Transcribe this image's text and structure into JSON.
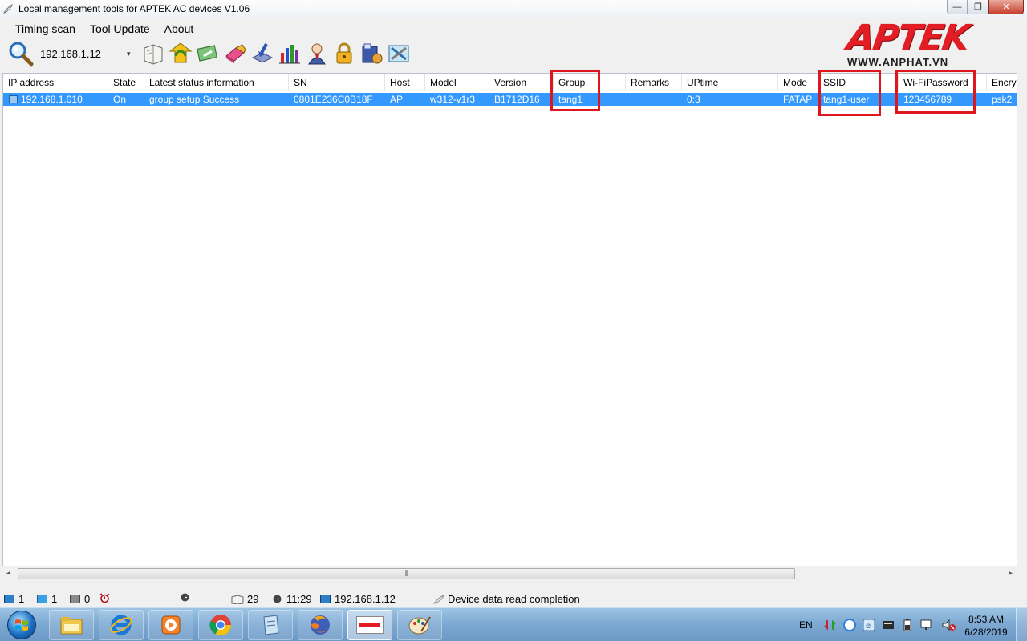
{
  "window": {
    "title": "Local management tools for APTEK AC devices  V1.06",
    "minimize": "—",
    "maximize": "❐",
    "close": "✕"
  },
  "menu": [
    "Timing scan",
    "Tool Update",
    "About"
  ],
  "toolbar": {
    "ip": "192.168.1.12",
    "combo_arrow": "▾"
  },
  "logo": {
    "mark": "APTEK",
    "url": "WWW.ANPHAT.VN"
  },
  "table": {
    "columns": [
      "IP address",
      "State",
      "Latest status information",
      "SN",
      "Host",
      "Model",
      "Version",
      "Group",
      "Remarks",
      "UPtime",
      "Mode",
      "SSID",
      "Wi-FiPassword",
      "Encry"
    ],
    "rows": [
      [
        "192.168.1.010",
        "On",
        "group setup Success",
        "0801E236C0B18F",
        "AP",
        "w312-v1r3",
        "B1712D16",
        "tang1",
        "",
        "0:3",
        "FATAP",
        "tang1-user",
        "123456789",
        "psk2"
      ]
    ]
  },
  "scrollbar": {
    "left": "◂",
    "right": "▸",
    "grip": "⦀"
  },
  "status": {
    "online": "1",
    "devices": "1",
    "offline": "0",
    "count": "29",
    "time": "11:29",
    "ip": "192.168.1.12",
    "message": "Device data read completion"
  },
  "tray": {
    "lang": "EN",
    "time": "8:53 AM",
    "date": "6/28/2019"
  },
  "colors": {
    "selection": "#3399ff",
    "highlight": "#e0161e",
    "brand": "#e21e24"
  }
}
